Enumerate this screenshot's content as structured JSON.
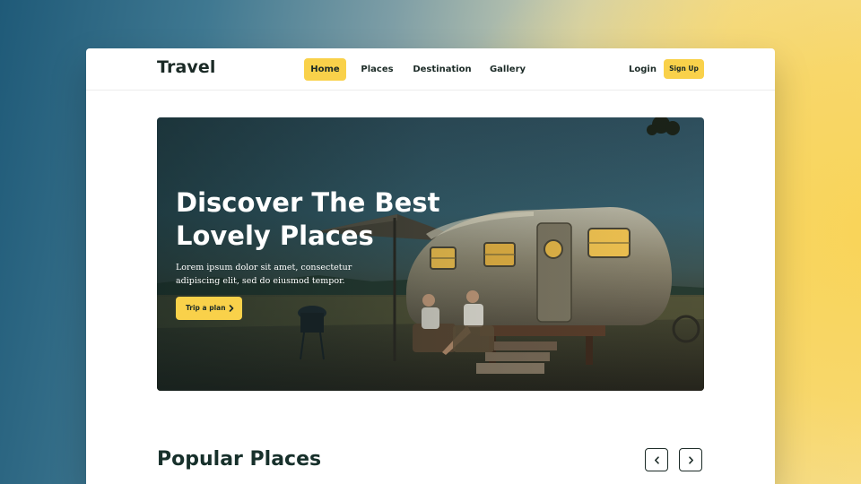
{
  "brand": {
    "logo": "Travel"
  },
  "nav": {
    "items": [
      {
        "label": "Home",
        "active": true
      },
      {
        "label": "Places",
        "active": false
      },
      {
        "label": "Destination",
        "active": false
      },
      {
        "label": "Gallery",
        "active": false
      }
    ],
    "login_label": "Login",
    "signup_label": "Sign Up"
  },
  "hero": {
    "title_line1": "Discover The Best",
    "title_line2": "Lovely Places",
    "description": "Lorem ipsum dolor sit amet, consectetur adipiscing elit, sed do eiusmod tempor.",
    "cta_label": "Trip a plan",
    "cta_icon": "chevron-right-icon",
    "image": "camper-trailer-evening-photo"
  },
  "popular": {
    "title": "Popular Places",
    "prev_icon": "chevron-left-icon",
    "next_icon": "chevron-right-icon"
  },
  "colors": {
    "accent": "#f9d14a",
    "text_dark": "#1b2a26",
    "card_bg": "#ffffff"
  }
}
